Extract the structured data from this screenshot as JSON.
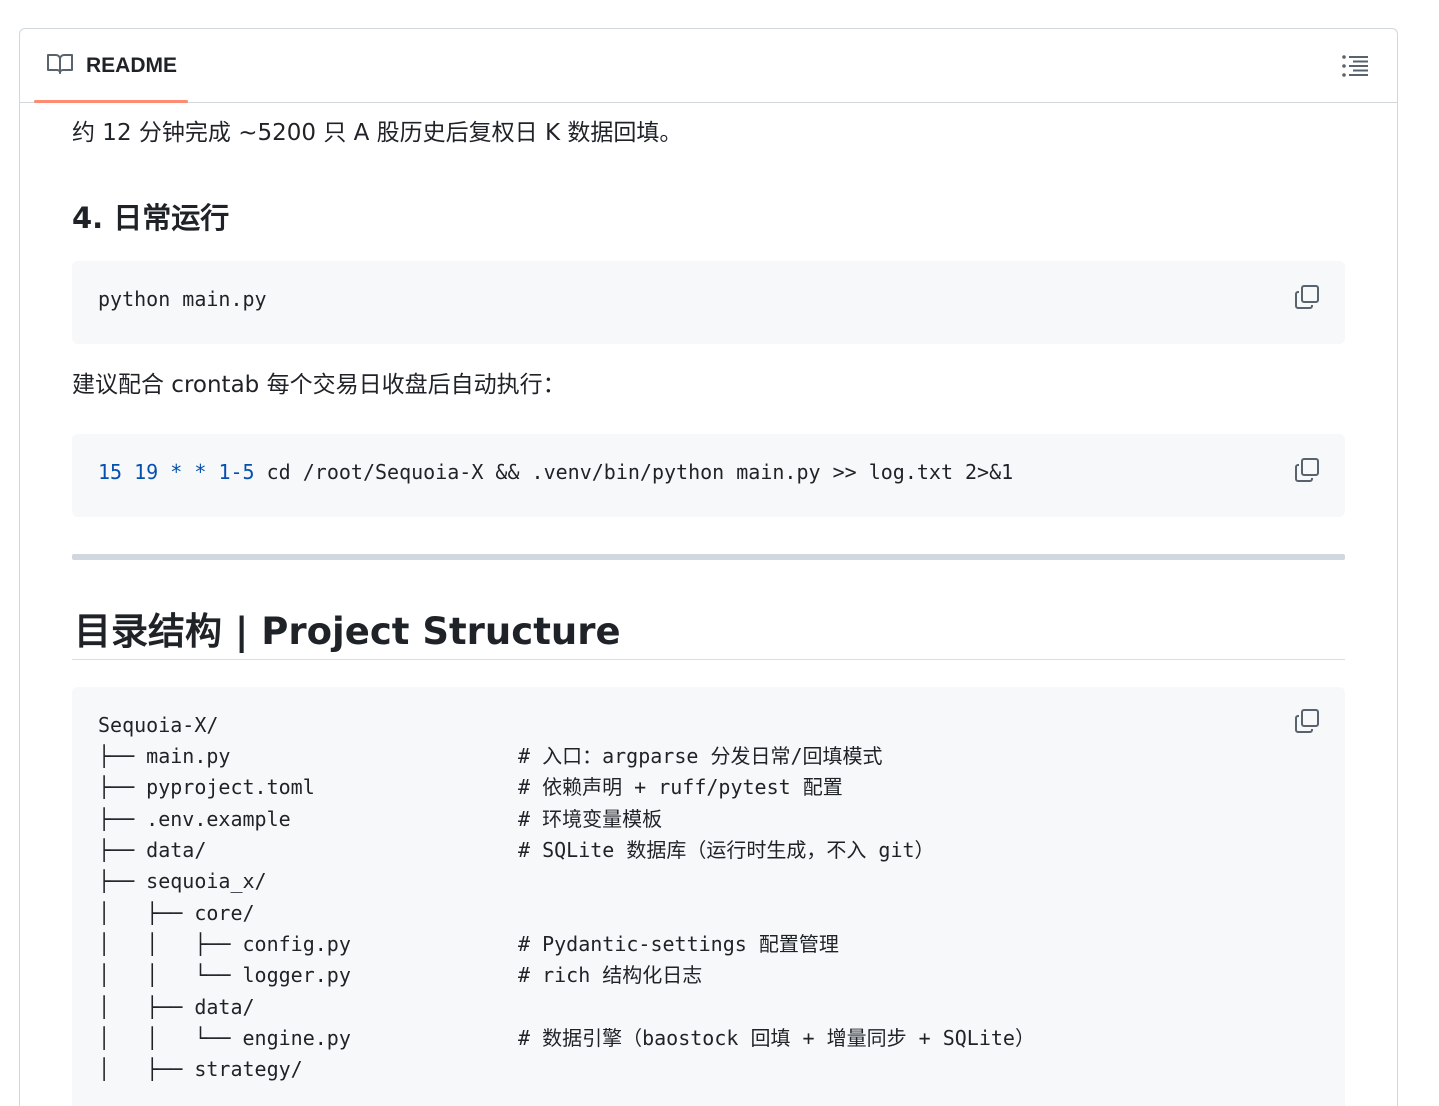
{
  "header": {
    "tab_label": "README",
    "icons": [
      "book-icon",
      "list-outline-icon"
    ]
  },
  "readme": {
    "intro": "约 12 分钟完成 ~5200 只 A 股历史后复权日 K 数据回填。",
    "section4_heading": "4. 日常运行",
    "code1": "python main.py",
    "crontab_intro": "建议配合 crontab 每个交易日收盘后自动执行：",
    "code2": {
      "num1": "15",
      "num2": "19",
      "star1": "*",
      "star2": "*",
      "range": "1-5",
      "rest": "cd /root/Sequoia-X && .venv/bin/python main.py >> log.txt 2>&1"
    },
    "structure_heading": "目录结构 | Project Structure",
    "tree": [
      {
        "path": "Sequoia-X/",
        "comment": ""
      },
      {
        "path": "├── main.py",
        "comment": "# 入口：argparse 分发日常/回填模式"
      },
      {
        "path": "├── pyproject.toml",
        "comment": "# 依赖声明 + ruff/pytest 配置"
      },
      {
        "path": "├── .env.example",
        "comment": "# 环境变量模板"
      },
      {
        "path": "├── data/",
        "comment": "# SQLite 数据库（运行时生成，不入 git）"
      },
      {
        "path": "├── sequoia_x/",
        "comment": ""
      },
      {
        "path": "│   ├── core/",
        "comment": ""
      },
      {
        "path": "│   │   ├── config.py",
        "comment": "# Pydantic-settings 配置管理"
      },
      {
        "path": "│   │   └── logger.py",
        "comment": "# rich 结构化日志"
      },
      {
        "path": "│   ├── data/",
        "comment": ""
      },
      {
        "path": "│   │   └── engine.py",
        "comment": "# 数据引擎（baostock 回填 + 增量同步 + SQLite）"
      },
      {
        "path": "│   ├── strategy/",
        "comment": ""
      }
    ]
  },
  "colors": {
    "tab_underline": "#fd8c73",
    "code_bg": "#f6f8fa",
    "number_blue": "#0550ae",
    "border": "#d0d7de"
  }
}
